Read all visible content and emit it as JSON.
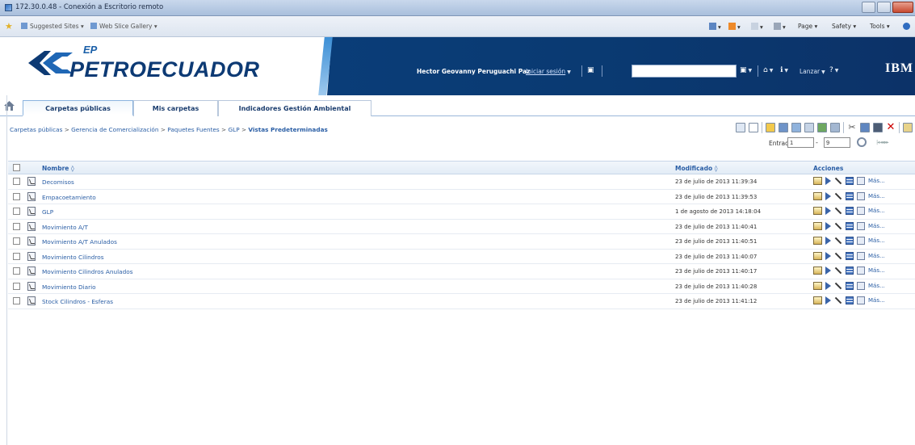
{
  "window": {
    "title": "172.30.0.48 - Conexión a Escritorio remoto",
    "colors": {
      "titlebar": "#a9bfdc",
      "close": "#c84a31"
    }
  },
  "favorites": {
    "items": [
      "Suggested Sites ▾",
      "Web Slice Gallery ▾"
    ],
    "commands": [
      "Page ▾",
      "Safety ▾",
      "Tools ▾"
    ]
  },
  "header": {
    "logo_ep": "EP",
    "logo_text": "PETROECUADOR",
    "user": "Hector Geovanny Peruguachi Paz",
    "login": "Iniciar sesión",
    "launch": "Lanzar",
    "ibm": "IBM",
    "colors": {
      "banner": "#0a3d78",
      "logo": "#0d3a74"
    }
  },
  "tabs": [
    {
      "label": "Carpetas públicas",
      "active": true
    },
    {
      "label": "Mis carpetas",
      "active": false
    },
    {
      "label": "Indicadores Gestión Ambiental",
      "active": false
    }
  ],
  "breadcrumb": [
    "Carpetas públicas",
    "Gerencia de Comercialización",
    "Paquetes Fuentes",
    "GLP",
    "Vistas Predeterminadas"
  ],
  "pager": {
    "entries_label": "Entradas:",
    "from": "1",
    "to": "9"
  },
  "table": {
    "headers": {
      "name": "Nombre",
      "modified": "Modificado",
      "actions": "Acciones"
    },
    "more_label": "Más...",
    "rows": [
      {
        "name": "Decomisos",
        "modified": "23 de julio de 2013 11:39:34"
      },
      {
        "name": "Empacoetamiento",
        "modified": "23 de julio de 2013 11:39:53"
      },
      {
        "name": "GLP",
        "modified": "1 de agosto de 2013 14:18:04"
      },
      {
        "name": "Movimiento A/T",
        "modified": "23 de julio de 2013 11:40:41"
      },
      {
        "name": "Movimiento A/T Anulados",
        "modified": "23 de julio de 2013 11:40:51"
      },
      {
        "name": "Movimiento Cilindros",
        "modified": "23 de julio de 2013 11:40:07"
      },
      {
        "name": "Movimiento Cilindros Anulados",
        "modified": "23 de julio de 2013 11:40:17"
      },
      {
        "name": "Movimiento Diario",
        "modified": "23 de julio de 2013 11:40:28"
      },
      {
        "name": "Stock Cilindros - Esferas",
        "modified": "23 de julio de 2013 11:41:12"
      }
    ]
  }
}
